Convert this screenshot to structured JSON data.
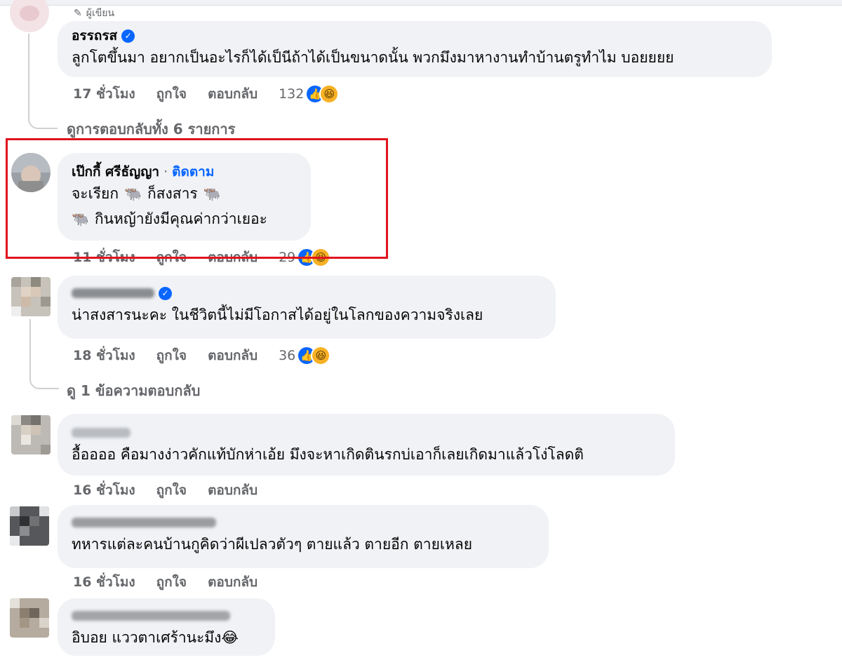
{
  "comments": [
    {
      "author_tag": "ผู้เขียน",
      "author": "อรรถรส",
      "verified": true,
      "text": "ลูกโตขึ้นมา อยากเป็นอะไรก็ได้เป็นีถ้าได้เป็นขนาดนั้น พวกมึงมาหางานทำบ้านตรูทำไม บอยยยย",
      "time": "17 ชั่วโมง",
      "like_label": "ถูกใจ",
      "reply_label": "ตอบกลับ",
      "reaction_count": "132",
      "view_replies": "ดูการตอบกลับทั้ง 6 รายการ"
    },
    {
      "author": "เป๊กกี้ ศรีธัญญา",
      "follow_label": "ติดตาม",
      "line1_a": "จะเรียก",
      "line1_b": "ก็สงสาร",
      "line2": "กินหญ้ายังมีคุณค่ากว่าเยอะ",
      "time": "11 ชั่วโมง",
      "like_label": "ถูกใจ",
      "reply_label": "ตอบกลับ",
      "reaction_count": "29"
    },
    {
      "verified": true,
      "text": "น่าสงสารนะคะ ในชีวิตนี้ไม่มีโอกาสได้อยู่ในโลกของความจริงเลย",
      "time": "18 ชั่วโมง",
      "like_label": "ถูกใจ",
      "reply_label": "ตอบกลับ",
      "reaction_count": "36",
      "view_replies": "ดู 1 ข้อความตอบกลับ"
    },
    {
      "text": "อื้ออออ คือมางง่าวคักแท้บักห่าเอ้ย มึงจะหาเกิดตินรกบ่เอาก็เลยเกิดมาแล้วโง่โลดติ",
      "time": "16 ชั่วโมง",
      "like_label": "ถูกใจ",
      "reply_label": "ตอบกลับ"
    },
    {
      "text": "ทหารแต่ละคนบ้านกูคิดว่าผีเปลวตัวๆ ตายแล้ว ตายอีก ตายเหลย",
      "time": "16 ชั่วโมง",
      "like_label": "ถูกใจ",
      "reply_label": "ตอบกลับ"
    },
    {
      "text": "อิบอย แววตาเศร้านะมึง😂"
    }
  ],
  "colors": {
    "bubble": "#f0f2f5",
    "meta": "#65676b",
    "accent": "#0866ff",
    "highlight": "#e0141e"
  },
  "icons": {
    "author_tag": "pencil-icon",
    "verified": "verified-badge-icon",
    "like": "like-reaction-icon",
    "haha": "haha-reaction-icon",
    "cow": "water-buffalo-emoji"
  }
}
